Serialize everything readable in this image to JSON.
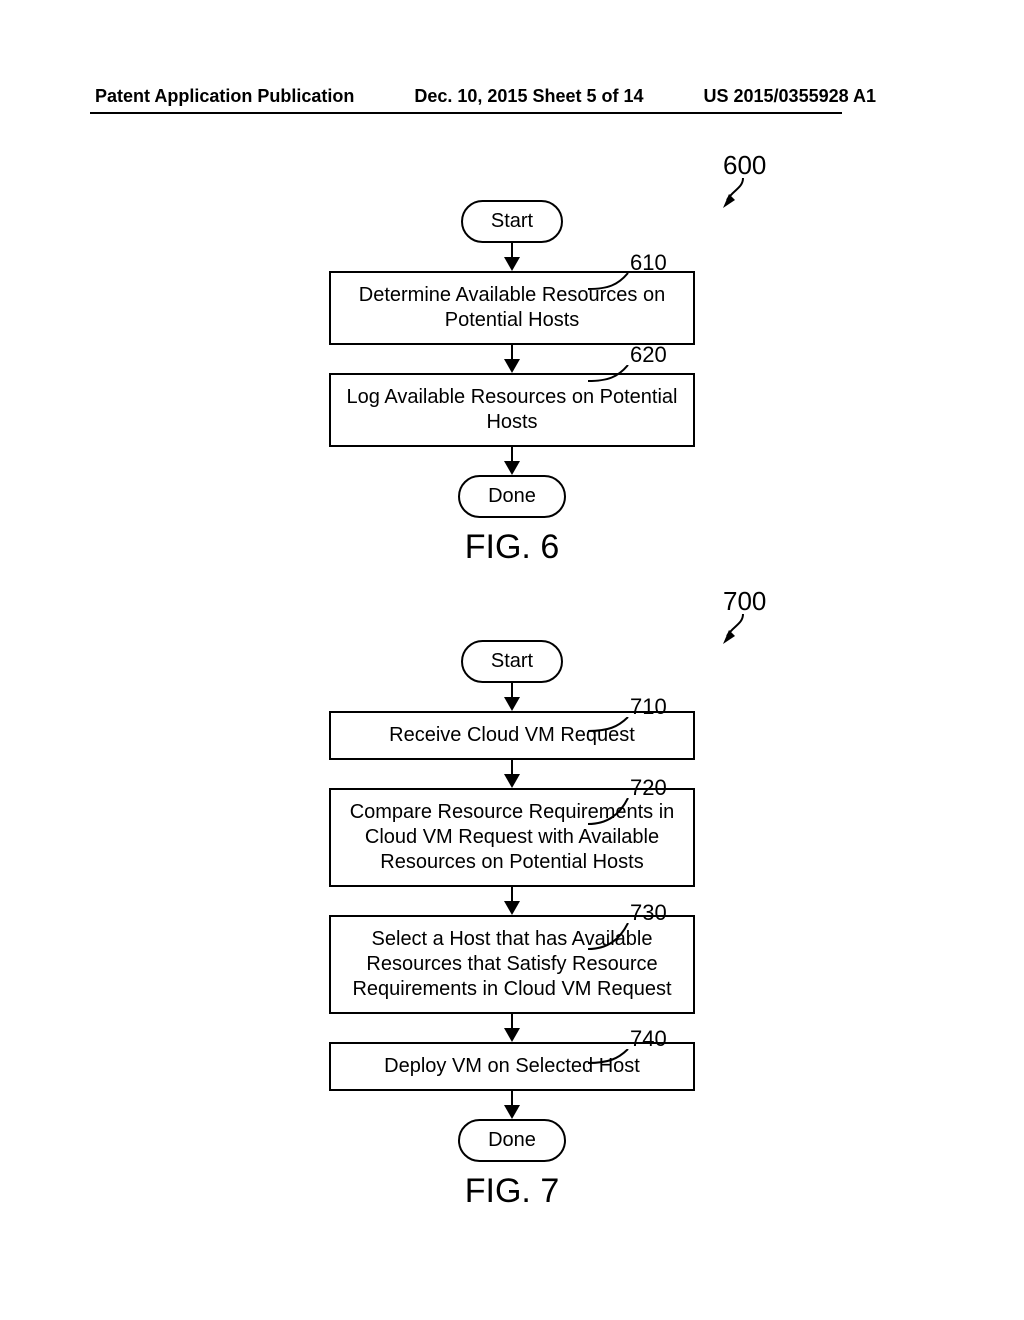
{
  "header": {
    "left": "Patent Application Publication",
    "center": "Dec. 10, 2015  Sheet 5 of 14",
    "right": "US 2015/0355928 A1"
  },
  "chart_data": [
    {
      "type": "table",
      "title": "FIG. 6 — flowchart",
      "ref": "600",
      "nodes": [
        {
          "id": "start",
          "kind": "terminal",
          "label": "Start"
        },
        {
          "id": "610",
          "kind": "process",
          "ref": "610",
          "label": "Determine Available Resources on Potential Hosts"
        },
        {
          "id": "620",
          "kind": "process",
          "ref": "620",
          "label": "Log Available Resources on Potential Hosts"
        },
        {
          "id": "done",
          "kind": "terminal",
          "label": "Done"
        }
      ],
      "edges": [
        {
          "from": "start",
          "to": "610"
        },
        {
          "from": "610",
          "to": "620"
        },
        {
          "from": "620",
          "to": "done"
        }
      ]
    },
    {
      "type": "table",
      "title": "FIG. 7 — flowchart",
      "ref": "700",
      "nodes": [
        {
          "id": "start",
          "kind": "terminal",
          "label": "Start"
        },
        {
          "id": "710",
          "kind": "process",
          "ref": "710",
          "label": "Receive Cloud VM Request"
        },
        {
          "id": "720",
          "kind": "process",
          "ref": "720",
          "label": "Compare Resource Requirements in Cloud VM Request with Available Resources on Potential Hosts"
        },
        {
          "id": "730",
          "kind": "process",
          "ref": "730",
          "label": "Select a Host that has Available Resources that Satisfy Resource Requirements in Cloud VM Request"
        },
        {
          "id": "740",
          "kind": "process",
          "ref": "740",
          "label": "Deploy VM on Selected Host"
        },
        {
          "id": "done",
          "kind": "terminal",
          "label": "Done"
        }
      ],
      "edges": [
        {
          "from": "start",
          "to": "710"
        },
        {
          "from": "710",
          "to": "720"
        },
        {
          "from": "720",
          "to": "730"
        },
        {
          "from": "730",
          "to": "740"
        },
        {
          "from": "740",
          "to": "done"
        }
      ]
    }
  ],
  "fig6": {
    "start": "Start",
    "step610": "Determine Available Resources on Potential Hosts",
    "step620": "Log Available Resources on Potential Hosts",
    "done": "Done",
    "caption": "FIG. 6",
    "ref_all": "600",
    "ref610": "610",
    "ref620": "620"
  },
  "fig7": {
    "start": "Start",
    "step710": "Receive Cloud VM Request",
    "step720": "Compare Resource Requirements in Cloud VM Request with Available Resources on Potential Hosts",
    "step730": "Select a Host that has Available Resources that Satisfy Resource Requirements in Cloud VM Request",
    "step740": "Deploy VM on Selected Host",
    "done": "Done",
    "caption": "FIG. 7",
    "ref_all": "700",
    "ref710": "710",
    "ref720": "720",
    "ref730": "730",
    "ref740": "740"
  }
}
